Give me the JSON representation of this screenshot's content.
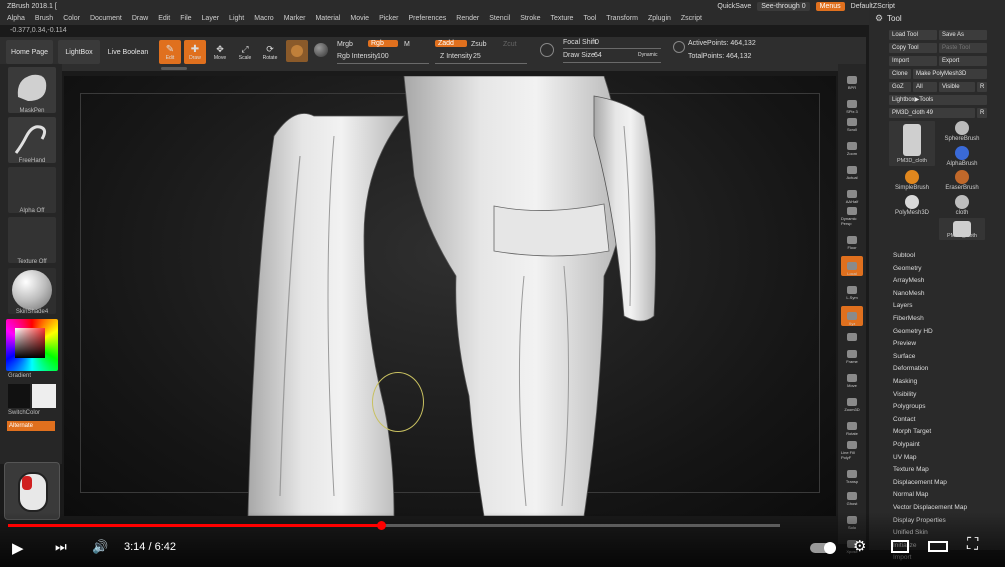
{
  "menubar": {
    "title": "ZBrush 2018.1 [",
    "menus": [
      "Alpha",
      "Brush",
      "Color",
      "Document",
      "Draw",
      "Edit",
      "File",
      "Layer",
      "Light",
      "Macro",
      "Marker",
      "Material",
      "Movie",
      "Picker",
      "Preferences",
      "Render",
      "Stencil",
      "Stroke",
      "Texture",
      "Tool",
      "Transform",
      "Zplugin",
      "Zscript"
    ],
    "quicksave": "QuickSave",
    "seethrough": "See-through  0",
    "menus_btn": "Menus",
    "script": "DefaultZScript"
  },
  "coord": "-0.377,0.34,-0.114",
  "toolbar": {
    "home_page": "Home Page",
    "lightbox": "LightBox",
    "live_boolean": "Live Boolean",
    "edit": "Edit",
    "draw": "Draw",
    "move": "Move",
    "scale": "Scale",
    "rotate": "Rotate",
    "mrgb": "Mrgb",
    "rgb": "Rgb",
    "m": "M",
    "rgb_intensity": "Rgb Intensity",
    "rgb_intensity_val": "100",
    "zadd": "Zadd",
    "zsub": "Zsub",
    "zcut": "Zcut",
    "z_intensity": "Z Intensity",
    "z_intensity_val": "25",
    "focal_shift": "Focal Shift",
    "focal_shift_val": "0",
    "draw_size": "Draw Size",
    "draw_size_val": "64",
    "dynamic": "Dynamic",
    "active_points": "ActivePoints: 464,132",
    "total_points": "TotalPoints: 464,132"
  },
  "left_shelf": {
    "brush1": "MaskPen",
    "brush2": "FreeHand",
    "alpha": "Alpha Off",
    "texture": "Texture Off",
    "material": "SkinShade4",
    "gradient": "Gradient",
    "switch_color": "SwitchColor",
    "alternate": "Alternate"
  },
  "right_shelf": [
    "BPR",
    "SPix 3",
    "Scroll",
    "Zoom",
    "Actual",
    "AAHalf",
    "Dynamic Persp",
    "Floor",
    "Local",
    "L.Sym",
    "Xyz",
    "",
    "Frame",
    "Move",
    "Zoom3D",
    "Rotate",
    "Line Fill PolyF",
    "Transp",
    "Ghost",
    "Solo",
    "Xpose"
  ],
  "tool_panel": {
    "title": "Tool",
    "load_tool": "Load Tool",
    "save_as": "Save As",
    "copy_tool": "Copy Tool",
    "paste_tool": "Paste Tool",
    "import": "Import",
    "export": "Export",
    "clone": "Clone",
    "make_polymesh": "Make PolyMesh3D",
    "goz": "GoZ",
    "all": "All",
    "visible": "Visible",
    "r": "R",
    "lightbox_tools": "Lightbox▶Tools",
    "current_tool": "PM3D_cloth  49",
    "r2": "R",
    "thumbs": [
      "PM3D_cloth",
      "SphereBrush",
      "AlphaBrush",
      "SimpleBrush",
      "EraserBrush",
      "PolyMesh3D",
      "cloth",
      "PM3D_cloth"
    ],
    "subpalettes": [
      "Subtool",
      "Geometry",
      "ArrayMesh",
      "NanoMesh",
      "Layers",
      "FiberMesh",
      "Geometry HD",
      "Preview",
      "Surface",
      "Deformation",
      "Masking",
      "Visibility",
      "Polygroups",
      "Contact",
      "Morph Target",
      "Polypaint",
      "UV Map",
      "Texture Map",
      "Displacement Map",
      "Normal Map",
      "Vector Displacement Map",
      "Display Properties",
      "Unified Skin",
      "Initialize",
      "Import"
    ]
  },
  "player": {
    "time": "3:14 / 6:42",
    "progress": 0.4826
  },
  "colors": {
    "accent": "#e0701e",
    "progress": "#ff0000"
  }
}
